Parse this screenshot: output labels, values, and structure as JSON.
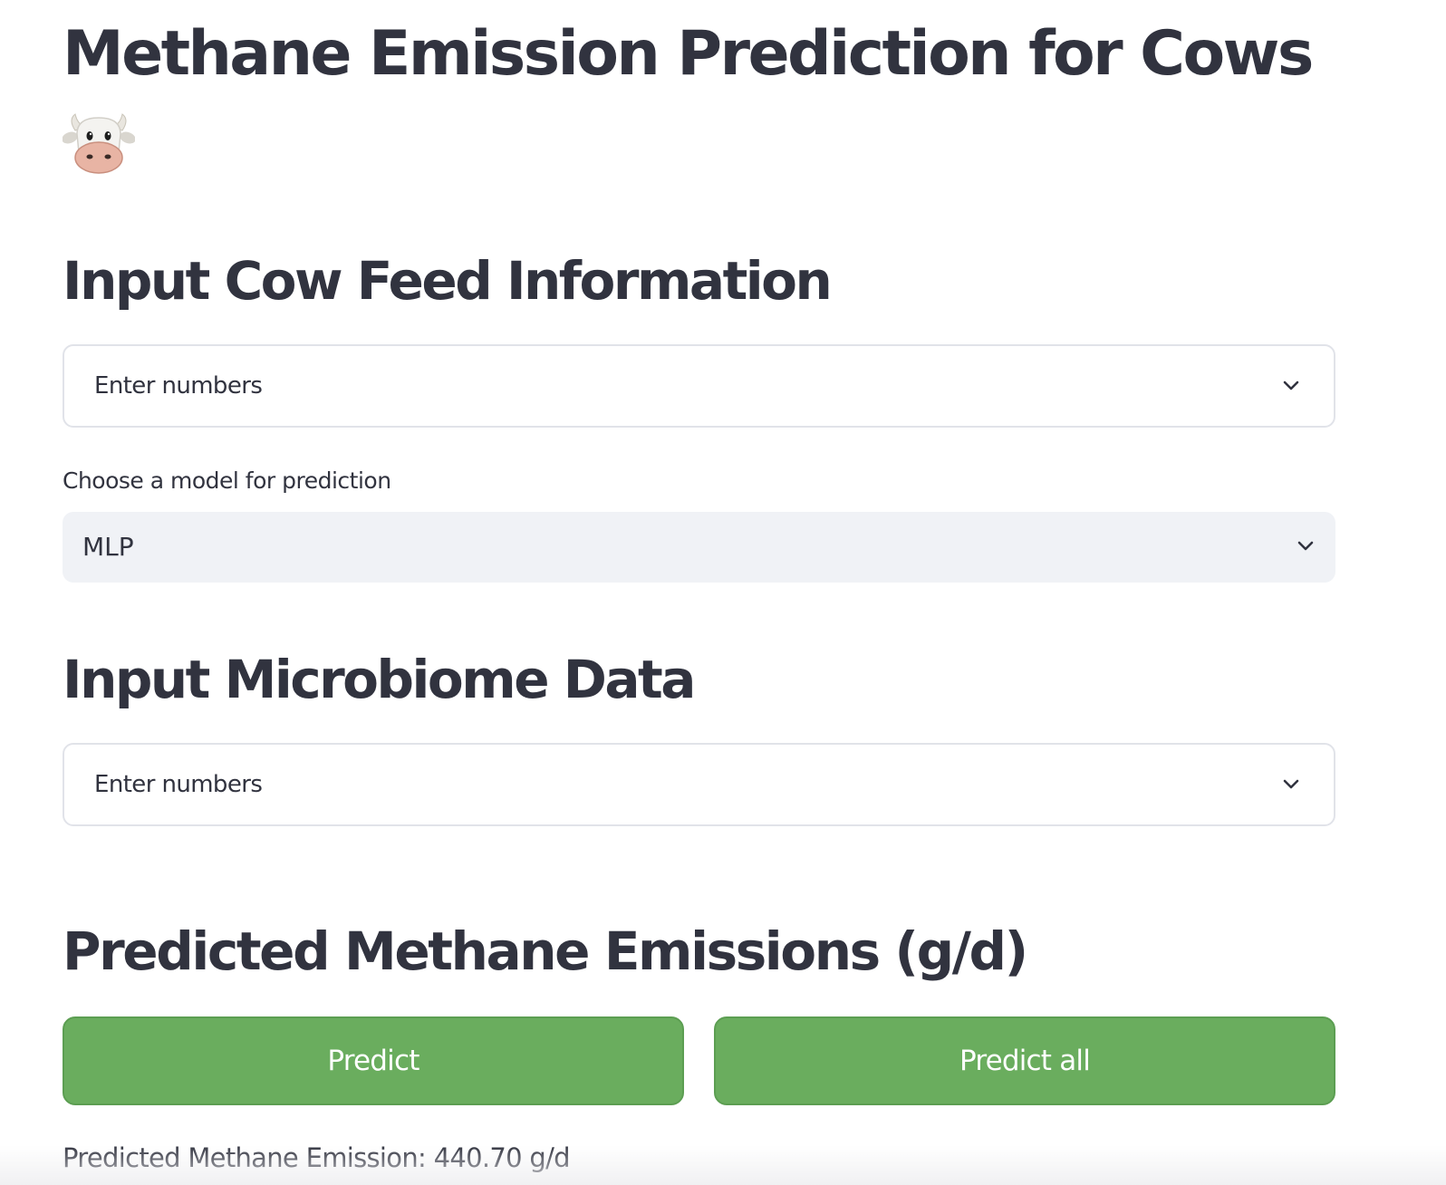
{
  "page": {
    "title": "Methane Emission Prediction for Cows",
    "title_icon": "cow-face-emoji"
  },
  "feed_section": {
    "heading": "Input Cow Feed Information",
    "expander_label": "Enter numbers",
    "expander_icon": "chevron-down-icon"
  },
  "model_select": {
    "label": "Choose a model for prediction",
    "selected_value": "MLP",
    "icon": "chevron-down-icon"
  },
  "microbiome_section": {
    "heading": "Input Microbiome Data",
    "expander_label": "Enter numbers",
    "expander_icon": "chevron-down-icon"
  },
  "prediction_section": {
    "heading": "Predicted Methane Emissions (g/d)",
    "predict_label": "Predict",
    "predict_all_label": "Predict all",
    "result_text": "Predicted Methane Emission: 440.70 g/d"
  },
  "colors": {
    "text": "#31333f",
    "button_green": "#6aad5e",
    "select_background": "#f0f2f6",
    "border": "#e1e3e9"
  }
}
